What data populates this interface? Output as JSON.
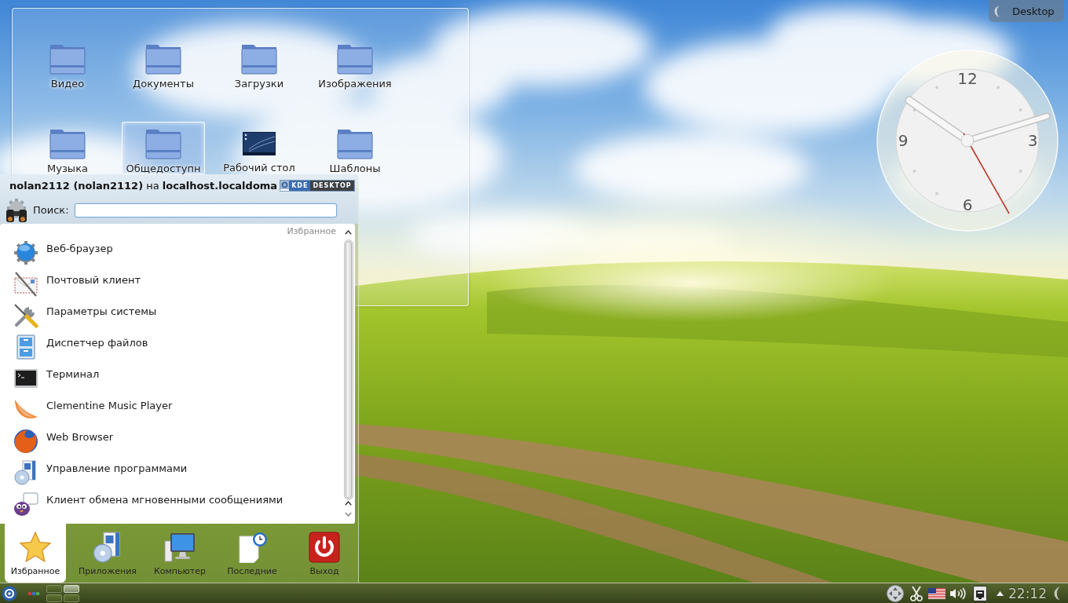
{
  "desktop_button": {
    "label": "Desktop"
  },
  "folder_view": {
    "items": [
      {
        "label": "Видео",
        "kind": "folder",
        "selected": false
      },
      {
        "label": "Документы",
        "kind": "folder",
        "selected": false
      },
      {
        "label": "Загрузки",
        "kind": "folder",
        "selected": false
      },
      {
        "label": "Изображения",
        "kind": "folder",
        "selected": false
      },
      {
        "label": "Музыка",
        "kind": "folder",
        "selected": false
      },
      {
        "label": "Общедоступн",
        "kind": "folder",
        "selected": true
      },
      {
        "label": "Рабочий стол",
        "kind": "desktop",
        "selected": false
      },
      {
        "label": "Шаблоны",
        "kind": "folder",
        "selected": false
      }
    ]
  },
  "clock": {
    "numerals": [
      "12",
      "3",
      "6",
      "9"
    ]
  },
  "launcher_menu": {
    "header": "**nolan2112 (nolan2112)** на **localhost.localdoma**",
    "logo": [
      "KDE",
      "DESKTOP"
    ],
    "search": {
      "label": "Поиск:"
    },
    "section_title": "Избранное",
    "items": [
      {
        "label": "Веб-браузер"
      },
      {
        "label": "Почтовый клиент"
      },
      {
        "label": "Параметры системы"
      },
      {
        "label": "Диспетчер файлов"
      },
      {
        "label": "Терминал"
      },
      {
        "label": "Clementine Music Player"
      },
      {
        "label": "Web Browser"
      },
      {
        "label": "Управление программами"
      },
      {
        "label": "Клиент обмена мгновенными сообщениями"
      }
    ],
    "tabs": [
      {
        "label": "Избранное",
        "selected": true
      },
      {
        "label": "Приложения",
        "selected": false
      },
      {
        "label": "Компьютер",
        "selected": false
      },
      {
        "label": "Последние",
        "selected": false
      },
      {
        "label": "Выход",
        "selected": false
      }
    ]
  },
  "taskbar": {
    "pager": [
      {
        "selected": false
      },
      {
        "selected": true
      },
      {
        "selected": false
      },
      {
        "selected": false
      }
    ],
    "time": "22:12"
  }
}
